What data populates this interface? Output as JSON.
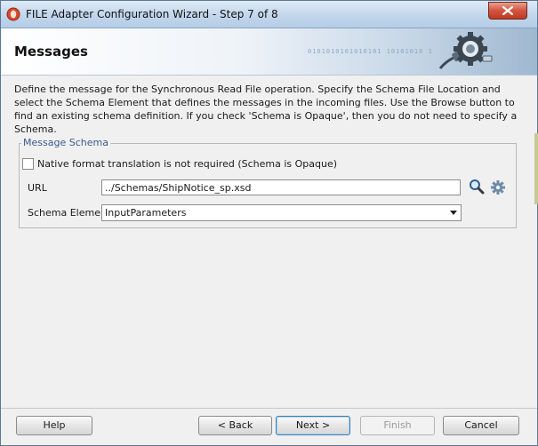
{
  "window": {
    "title": "FILE Adapter Configuration Wizard - Step 7 of 8",
    "close_icon": "close-x-icon"
  },
  "header": {
    "title": "Messages",
    "graphic_icon": "adapter-gear-plug-icon",
    "binary_text": "0101010101010101 10101010 1"
  },
  "description": "Define the message for the Synchronous Read File operation.  Specify the Schema File Location and select the Schema Element that defines the messages in the incoming files. Use the Browse button to find an existing schema definition. If you check 'Schema is Opaque', then you do not need to specify a Schema.",
  "message_schema": {
    "legend": "Message Schema",
    "opaque_checkbox": {
      "label": "Native format translation is not required (Schema is Opaque)",
      "checked": false
    },
    "url": {
      "label": "URL",
      "value": "../Schemas/ShipNotice_sp.xsd",
      "search_icon": "magnifier-search-icon",
      "gear_icon": "gear-icon"
    },
    "schema_element": {
      "label": "Schema Element",
      "selected": "InputParameters"
    }
  },
  "buttons": {
    "help": "Help",
    "back": "< Back",
    "next": "Next >",
    "finish": "Finish",
    "cancel": "Cancel"
  }
}
